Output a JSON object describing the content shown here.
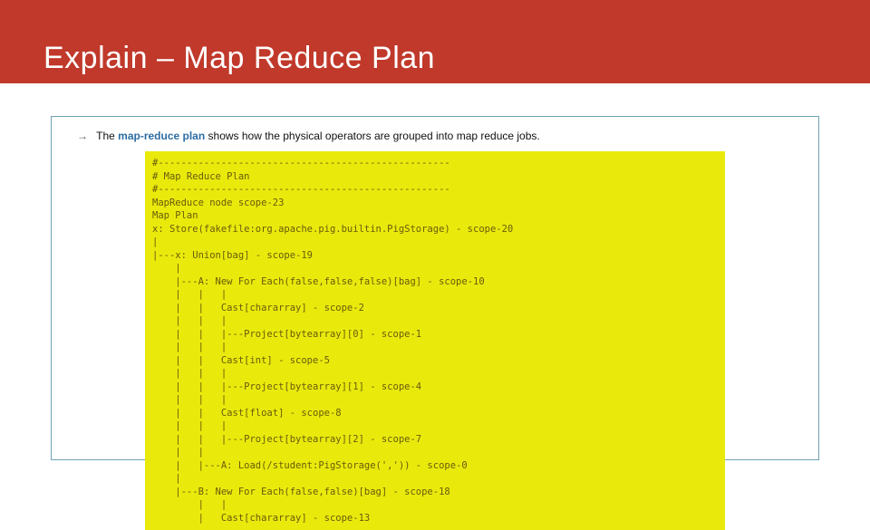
{
  "header": {
    "title": "Explain – Map Reduce Plan"
  },
  "intro": {
    "arrow": "→",
    "prefix": "The",
    "keyword": "map-reduce plan",
    "suffix": "shows how the physical operators are grouped into map reduce jobs."
  },
  "plan": {
    "lines": [
      "#---------------------------------------------------",
      "# Map Reduce Plan",
      "#---------------------------------------------------",
      "MapReduce node scope-23",
      "Map Plan",
      "x: Store(fakefile:org.apache.pig.builtin.PigStorage) - scope-20",
      "|",
      "|---x: Union[bag] - scope-19",
      "    |",
      "    |---A: New For Each(false,false,false)[bag] - scope-10",
      "    |   |   |",
      "    |   |   Cast[chararray] - scope-2",
      "    |   |   |",
      "    |   |   |---Project[bytearray][0] - scope-1",
      "    |   |   |",
      "    |   |   Cast[int] - scope-5",
      "    |   |   |",
      "    |   |   |---Project[bytearray][1] - scope-4",
      "    |   |   |",
      "    |   |   Cast[float] - scope-8",
      "    |   |   |",
      "    |   |   |---Project[bytearray][2] - scope-7",
      "    |   |",
      "    |   |---A: Load(/student:PigStorage(',')) - scope-0",
      "    |",
      "    |---B: New For Each(false,false)[bag] - scope-18",
      "        |   |",
      "        |   Cast[chararray] - scope-13"
    ]
  }
}
